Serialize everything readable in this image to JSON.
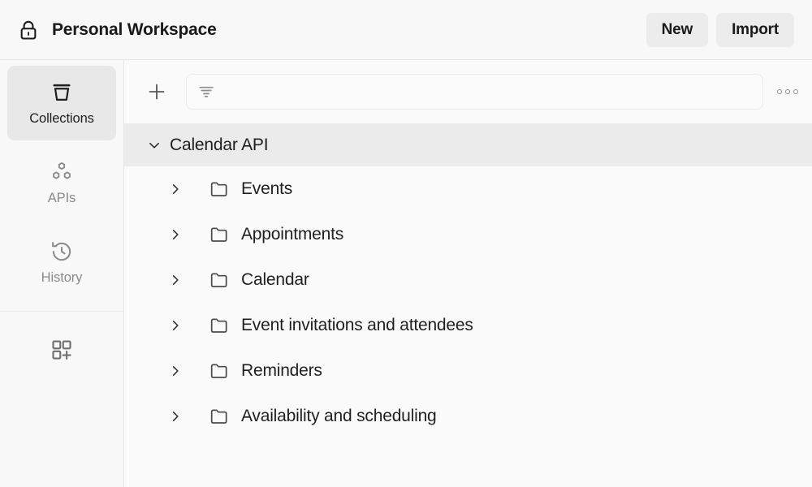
{
  "header": {
    "workspace_icon": "lock-icon",
    "title": "Personal Workspace",
    "new_label": "New",
    "import_label": "Import"
  },
  "sidebar": {
    "items": [
      {
        "label": "Collections",
        "icon": "collections-basket-icon",
        "active": true
      },
      {
        "label": "APIs",
        "icon": "apis-hexagons-icon",
        "active": false
      },
      {
        "label": "History",
        "icon": "history-clock-icon",
        "active": false
      }
    ],
    "bottom_icon": "add-module-grid-plus-icon"
  },
  "toolbar": {
    "add_icon": "plus-icon",
    "filter_icon": "filter-icon",
    "filter_value": "",
    "filter_placeholder": "",
    "more_icon": "more-options-icon"
  },
  "tree": {
    "root": {
      "label": "Calendar API",
      "expanded": true,
      "chevron_icon": "chevron-down-icon"
    },
    "items": [
      {
        "label": "Events",
        "icon": "folder-icon",
        "chevron_icon": "chevron-right-icon",
        "expanded": false
      },
      {
        "label": "Appointments",
        "icon": "folder-icon",
        "chevron_icon": "chevron-right-icon",
        "expanded": false
      },
      {
        "label": "Calendar",
        "icon": "folder-icon",
        "chevron_icon": "chevron-right-icon",
        "expanded": false
      },
      {
        "label": "Event invitations and attendees",
        "icon": "folder-icon",
        "chevron_icon": "chevron-right-icon",
        "expanded": false
      },
      {
        "label": "Reminders",
        "icon": "folder-icon",
        "chevron_icon": "chevron-right-icon",
        "expanded": false
      },
      {
        "label": "Availability and scheduling",
        "icon": "folder-icon",
        "chevron_icon": "chevron-right-icon",
        "expanded": false
      }
    ]
  },
  "colors": {
    "page_background": "#fafafa",
    "header_background": "#f8f8f8",
    "rail_background": "#f8f8f8",
    "active_item_background": "#e8e8e8",
    "root_row_background": "#ebebeb",
    "button_background": "#ececec",
    "text_primary": "#1f1f1f",
    "text_muted": "#8a8a8a",
    "border": "#e6e6e6"
  }
}
